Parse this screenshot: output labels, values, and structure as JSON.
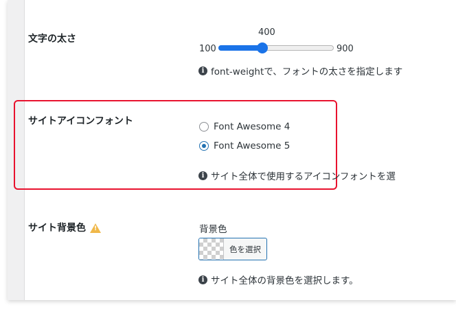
{
  "font_weight": {
    "label": "文字の太さ",
    "value": "400",
    "min": "100",
    "max": "900",
    "level_fraction": 0.375,
    "hint": "font-weightで、フォントの太さを指定します"
  },
  "icon_font": {
    "label": "サイトアイコンフォント",
    "options": [
      "Font Awesome 4",
      "Font Awesome 5"
    ],
    "selected": "Font Awesome 5",
    "hint": "サイト全体で使用するアイコンフォントを選"
  },
  "bg_color": {
    "label": "サイト背景色",
    "field_label": "背景色",
    "button_label": "色を選択",
    "hint": "サイト全体の背景色を選択します。"
  },
  "colors": {
    "accent": "#1a73e8",
    "highlight": "#e8112d",
    "warning": "#f0b849"
  }
}
